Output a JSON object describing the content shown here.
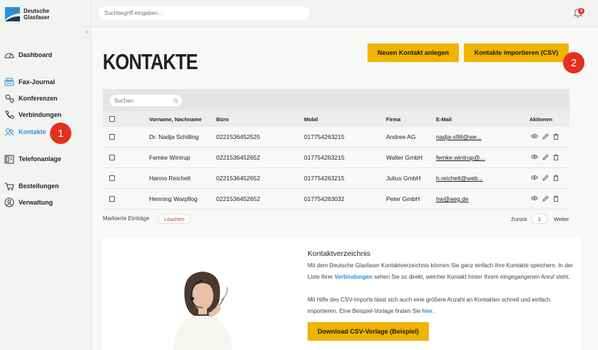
{
  "brand": {
    "line1": "Deutsche",
    "line2": "Glasfaser"
  },
  "search_top": {
    "placeholder": "Suchbegriff eingeben..."
  },
  "notifications": {
    "count": "3"
  },
  "nav": {
    "dashboard": "Dashboard",
    "fax": "Fax-Journal",
    "konferenzen": "Konferenzen",
    "verbindungen": "Verbindungen",
    "kontakte": "Kontakte",
    "telefonanlage": "Telefonanlage",
    "bestellungen": "Bestellungen",
    "verwaltung": "Verwaltung"
  },
  "badges": {
    "one": "1",
    "two": "2"
  },
  "page": {
    "title": "KONTAKTE",
    "new_contact": "Neuen Kontakt anlegen",
    "import_csv": "Kontakte importieren (CSV)"
  },
  "table": {
    "search_placeholder": "Suchen",
    "columns": {
      "name": "Vorname, Nachname",
      "buero": "Büro",
      "mobil": "Mobil",
      "firma": "Firma",
      "email": "E-Mail",
      "aktionen": "Aktionen"
    },
    "rows": [
      {
        "name": "Dr. Nadja Schilling",
        "buero": "0221536452525",
        "mobil": "017754263215",
        "firma": "Andree AG",
        "email": "nadja-s98@we..."
      },
      {
        "name": "Femke Wintrup",
        "buero": "0221536452652",
        "mobil": "017754263215",
        "firma": "Walter GmbH",
        "email": "femke.wintrup@..."
      },
      {
        "name": "Hanno Reichelt",
        "buero": "0221536452652",
        "mobil": "017754263215",
        "firma": "Julius GmbH",
        "email": "h.reichelt@web..."
      },
      {
        "name": "Henning Warpflog",
        "buero": "0221536452652",
        "mobil": "017754263032",
        "firma": "Peter GmbH",
        "email": "hw@aeg.de"
      }
    ],
    "marked": "Markierte Einträge",
    "delete": "Löschen",
    "back": "Zurück",
    "page": "1",
    "next": "Weiter"
  },
  "info": {
    "title": "Kontaktverzeichnis",
    "p1_a": "Mit dem Deutsche Glasfaser Kontaktverzeichnis können Sie ganz einfach Ihre Kontakte speichern. In der Liste Ihrer ",
    "p1_link": "Verbindungen",
    "p1_b": " sehen Sie so direkt, welcher Kontakt hinter Ihrem eingegangenen Anruf steht.",
    "p2_a": "Mit Hilfe des CSV-Imports lässt sich auch eine größere Anzahl an Kontakten schnell und einfach importieren. Eine Beispiel-Vorlage finden Sie ",
    "p2_link": "hier",
    "p2_b": ".",
    "download": "Download CSV-Vorlage (Beispiel)"
  },
  "colors": {
    "accent": "#f0b400",
    "link": "#2b8fd6",
    "badge": "#e42f1e"
  }
}
